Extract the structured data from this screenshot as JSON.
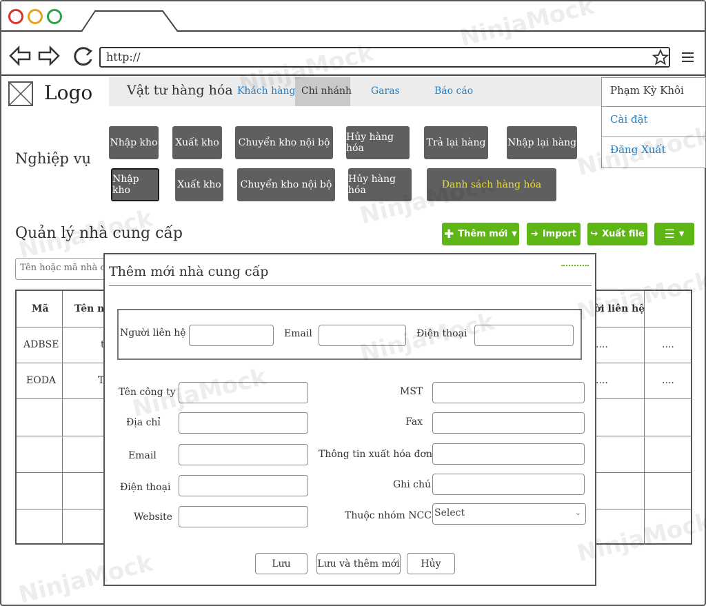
{
  "browser": {
    "url": "http://",
    "dot_colors": [
      "#d9342b",
      "#e6a21a",
      "#2aa14a"
    ]
  },
  "header": {
    "logo": "Logo",
    "nav_main": "Vật tư hàng hóa",
    "nav_items": [
      "Khách hàng",
      "Chi nhánh",
      "Garas",
      "Báo cáo"
    ],
    "active_item": "Chi nhánh"
  },
  "user_menu": {
    "name": "Phạm Kỳ Khôi",
    "items": [
      "Cài đặt",
      "Đăng Xuất"
    ]
  },
  "operations": {
    "label": "Nghiệp vụ",
    "row1": [
      "Nhập kho",
      "Xuất kho",
      "Chuyển kho nội bộ",
      "Hủy hàng hóa",
      "Trả lại hàng",
      "Nhập lại hàng"
    ],
    "row2": [
      "Nhập kho",
      "Xuất kho",
      "Chuyển kho nội bộ",
      "Hủy hàng hóa",
      "Danh sách hàng hóa"
    ],
    "highlight_color": "#f0e130"
  },
  "page": {
    "title": "Quản lý nhà cung cấp",
    "search_placeholder": "Tên hoặc mã nhà cu",
    "buttons": {
      "add": "Thêm mới",
      "import": "Import",
      "export": "Xuất file"
    },
    "accent_color": "#5eb614"
  },
  "table": {
    "headers": [
      "Mã",
      "Tên nh",
      "ời liên hệ"
    ],
    "rows": [
      {
        "code": "ADBSE",
        "name": "t",
        "col3": "....",
        "col4": "...."
      },
      {
        "code": "EODA",
        "name": "T",
        "col3": "....",
        "col4": "...."
      }
    ]
  },
  "modal": {
    "title": "Thêm mới nhà cung cấp",
    "contact_group": {
      "person_label": "Người liên hệ",
      "email_label": "Email",
      "phone_label": "Điện thoại"
    },
    "left_labels": [
      "Tên công ty",
      "Địa chỉ",
      "Email",
      "Điện thoại",
      "Website"
    ],
    "right_labels": [
      "MST",
      "Fax",
      "Thông tin xuất hóa đơn",
      "Ghi chú",
      "Thuộc nhóm NCC"
    ],
    "select_value": "Select",
    "buttons": {
      "save": "Lưu",
      "save_new": "Lưu và thêm mới",
      "cancel": "Hủy"
    }
  }
}
